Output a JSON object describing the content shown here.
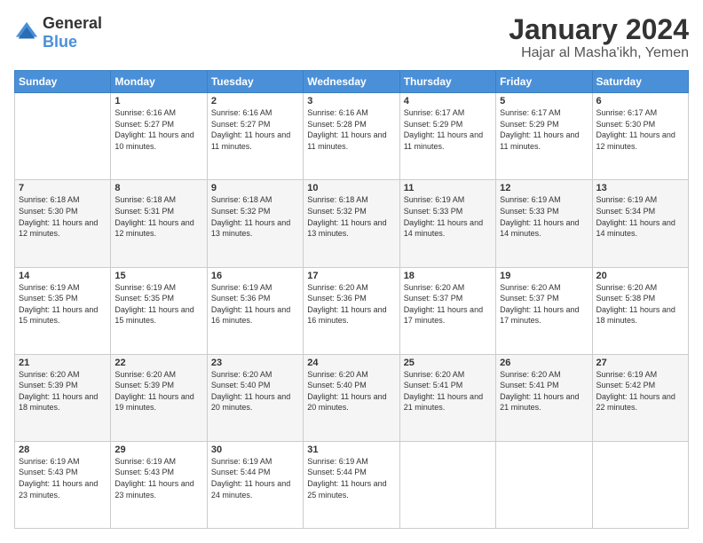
{
  "logo": {
    "general": "General",
    "blue": "Blue"
  },
  "title": {
    "month_year": "January 2024",
    "location": "Hajar al Masha'ikh, Yemen"
  },
  "days_of_week": [
    "Sunday",
    "Monday",
    "Tuesday",
    "Wednesday",
    "Thursday",
    "Friday",
    "Saturday"
  ],
  "weeks": [
    [
      {
        "day": "",
        "sunrise": "",
        "sunset": "",
        "daylight": ""
      },
      {
        "day": "1",
        "sunrise": "Sunrise: 6:16 AM",
        "sunset": "Sunset: 5:27 PM",
        "daylight": "Daylight: 11 hours and 10 minutes."
      },
      {
        "day": "2",
        "sunrise": "Sunrise: 6:16 AM",
        "sunset": "Sunset: 5:27 PM",
        "daylight": "Daylight: 11 hours and 11 minutes."
      },
      {
        "day": "3",
        "sunrise": "Sunrise: 6:16 AM",
        "sunset": "Sunset: 5:28 PM",
        "daylight": "Daylight: 11 hours and 11 minutes."
      },
      {
        "day": "4",
        "sunrise": "Sunrise: 6:17 AM",
        "sunset": "Sunset: 5:29 PM",
        "daylight": "Daylight: 11 hours and 11 minutes."
      },
      {
        "day": "5",
        "sunrise": "Sunrise: 6:17 AM",
        "sunset": "Sunset: 5:29 PM",
        "daylight": "Daylight: 11 hours and 11 minutes."
      },
      {
        "day": "6",
        "sunrise": "Sunrise: 6:17 AM",
        "sunset": "Sunset: 5:30 PM",
        "daylight": "Daylight: 11 hours and 12 minutes."
      }
    ],
    [
      {
        "day": "7",
        "sunrise": "Sunrise: 6:18 AM",
        "sunset": "Sunset: 5:30 PM",
        "daylight": "Daylight: 11 hours and 12 minutes."
      },
      {
        "day": "8",
        "sunrise": "Sunrise: 6:18 AM",
        "sunset": "Sunset: 5:31 PM",
        "daylight": "Daylight: 11 hours and 12 minutes."
      },
      {
        "day": "9",
        "sunrise": "Sunrise: 6:18 AM",
        "sunset": "Sunset: 5:32 PM",
        "daylight": "Daylight: 11 hours and 13 minutes."
      },
      {
        "day": "10",
        "sunrise": "Sunrise: 6:18 AM",
        "sunset": "Sunset: 5:32 PM",
        "daylight": "Daylight: 11 hours and 13 minutes."
      },
      {
        "day": "11",
        "sunrise": "Sunrise: 6:19 AM",
        "sunset": "Sunset: 5:33 PM",
        "daylight": "Daylight: 11 hours and 14 minutes."
      },
      {
        "day": "12",
        "sunrise": "Sunrise: 6:19 AM",
        "sunset": "Sunset: 5:33 PM",
        "daylight": "Daylight: 11 hours and 14 minutes."
      },
      {
        "day": "13",
        "sunrise": "Sunrise: 6:19 AM",
        "sunset": "Sunset: 5:34 PM",
        "daylight": "Daylight: 11 hours and 14 minutes."
      }
    ],
    [
      {
        "day": "14",
        "sunrise": "Sunrise: 6:19 AM",
        "sunset": "Sunset: 5:35 PM",
        "daylight": "Daylight: 11 hours and 15 minutes."
      },
      {
        "day": "15",
        "sunrise": "Sunrise: 6:19 AM",
        "sunset": "Sunset: 5:35 PM",
        "daylight": "Daylight: 11 hours and 15 minutes."
      },
      {
        "day": "16",
        "sunrise": "Sunrise: 6:19 AM",
        "sunset": "Sunset: 5:36 PM",
        "daylight": "Daylight: 11 hours and 16 minutes."
      },
      {
        "day": "17",
        "sunrise": "Sunrise: 6:20 AM",
        "sunset": "Sunset: 5:36 PM",
        "daylight": "Daylight: 11 hours and 16 minutes."
      },
      {
        "day": "18",
        "sunrise": "Sunrise: 6:20 AM",
        "sunset": "Sunset: 5:37 PM",
        "daylight": "Daylight: 11 hours and 17 minutes."
      },
      {
        "day": "19",
        "sunrise": "Sunrise: 6:20 AM",
        "sunset": "Sunset: 5:37 PM",
        "daylight": "Daylight: 11 hours and 17 minutes."
      },
      {
        "day": "20",
        "sunrise": "Sunrise: 6:20 AM",
        "sunset": "Sunset: 5:38 PM",
        "daylight": "Daylight: 11 hours and 18 minutes."
      }
    ],
    [
      {
        "day": "21",
        "sunrise": "Sunrise: 6:20 AM",
        "sunset": "Sunset: 5:39 PM",
        "daylight": "Daylight: 11 hours and 18 minutes."
      },
      {
        "day": "22",
        "sunrise": "Sunrise: 6:20 AM",
        "sunset": "Sunset: 5:39 PM",
        "daylight": "Daylight: 11 hours and 19 minutes."
      },
      {
        "day": "23",
        "sunrise": "Sunrise: 6:20 AM",
        "sunset": "Sunset: 5:40 PM",
        "daylight": "Daylight: 11 hours and 20 minutes."
      },
      {
        "day": "24",
        "sunrise": "Sunrise: 6:20 AM",
        "sunset": "Sunset: 5:40 PM",
        "daylight": "Daylight: 11 hours and 20 minutes."
      },
      {
        "day": "25",
        "sunrise": "Sunrise: 6:20 AM",
        "sunset": "Sunset: 5:41 PM",
        "daylight": "Daylight: 11 hours and 21 minutes."
      },
      {
        "day": "26",
        "sunrise": "Sunrise: 6:20 AM",
        "sunset": "Sunset: 5:41 PM",
        "daylight": "Daylight: 11 hours and 21 minutes."
      },
      {
        "day": "27",
        "sunrise": "Sunrise: 6:19 AM",
        "sunset": "Sunset: 5:42 PM",
        "daylight": "Daylight: 11 hours and 22 minutes."
      }
    ],
    [
      {
        "day": "28",
        "sunrise": "Sunrise: 6:19 AM",
        "sunset": "Sunset: 5:43 PM",
        "daylight": "Daylight: 11 hours and 23 minutes."
      },
      {
        "day": "29",
        "sunrise": "Sunrise: 6:19 AM",
        "sunset": "Sunset: 5:43 PM",
        "daylight": "Daylight: 11 hours and 23 minutes."
      },
      {
        "day": "30",
        "sunrise": "Sunrise: 6:19 AM",
        "sunset": "Sunset: 5:44 PM",
        "daylight": "Daylight: 11 hours and 24 minutes."
      },
      {
        "day": "31",
        "sunrise": "Sunrise: 6:19 AM",
        "sunset": "Sunset: 5:44 PM",
        "daylight": "Daylight: 11 hours and 25 minutes."
      },
      {
        "day": "",
        "sunrise": "",
        "sunset": "",
        "daylight": ""
      },
      {
        "day": "",
        "sunrise": "",
        "sunset": "",
        "daylight": ""
      },
      {
        "day": "",
        "sunrise": "",
        "sunset": "",
        "daylight": ""
      }
    ]
  ]
}
